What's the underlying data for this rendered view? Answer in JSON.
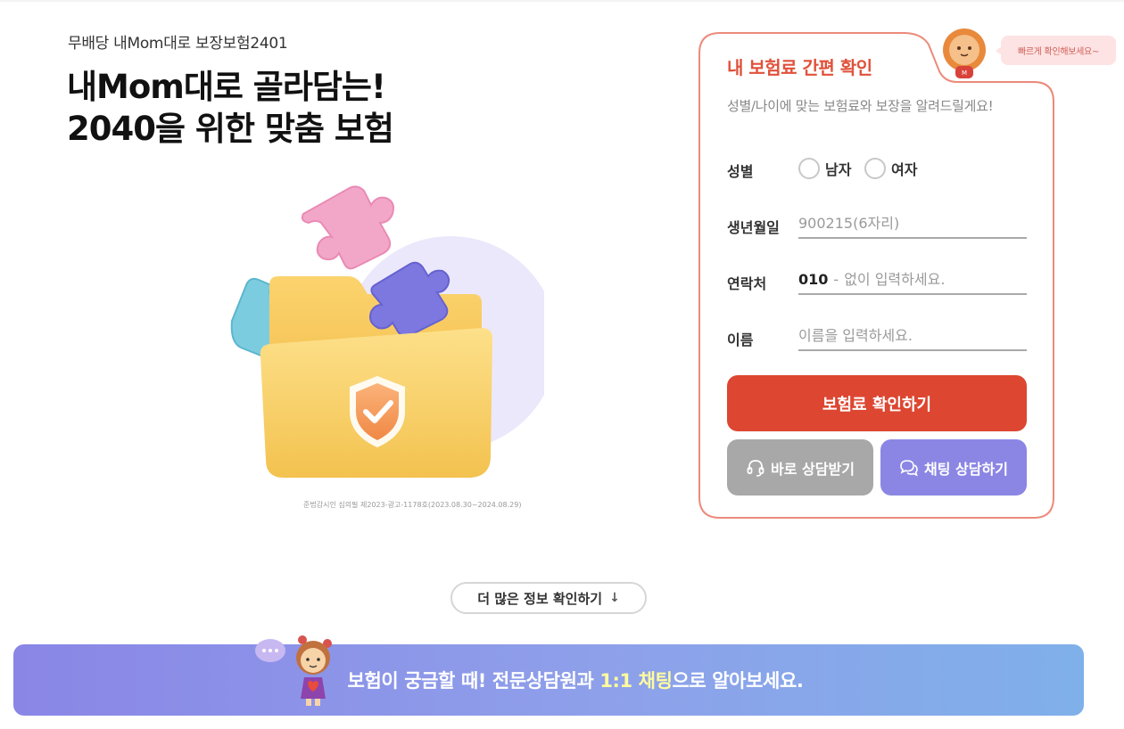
{
  "product_name": "무배당 내Mom대로 보장보험2401",
  "headline": {
    "line1": "내Mom대로 골라담는!",
    "line2": "2040을 위한 맞춤 보험"
  },
  "disclaimer": "준법감시인 심의필 제2023-광고-1178호(2023.08.30~2024.08.29)",
  "speech_bubble": "빠르게 확인해보세요~",
  "quote": {
    "title": "내 보험료 간편 확인",
    "description": "성별/나이에 맞는 보험료와 보장을 알려드릴게요!",
    "gender_label": "성별",
    "gender_male": "남자",
    "gender_female": "여자",
    "birth_label": "생년월일",
    "birth_placeholder": "900215(6자리)",
    "phone_label": "연락처",
    "phone_prefix": "010",
    "phone_dash": "-",
    "phone_placeholder": "없이 입력하세요.",
    "name_label": "이름",
    "name_placeholder": "이름을 입력하세요.",
    "submit_label": "보험료 확인하기",
    "call_label": "바로 상담받기",
    "chat_label": "채팅 상담하기"
  },
  "more_info_label": "더 많은 정보 확인하기",
  "more_info_arrow": "↓",
  "banner": {
    "text_before": "보험이 궁금할 때!  전문상담원과 ",
    "highlight": "1:1 채팅",
    "text_after": "으로 알아보세요."
  },
  "colors": {
    "accent_red": "#dd4631",
    "call_gray": "#a8a8a8",
    "chat_purple": "#8b86e4",
    "title_red": "#e0513a",
    "card_border": "#ec8a7a"
  },
  "icons": [
    "headset-icon",
    "chat-bubbles-icon",
    "down-arrow-icon",
    "lion-mascot-icon",
    "girl-mascot-icon",
    "folder-shield-illustration"
  ]
}
